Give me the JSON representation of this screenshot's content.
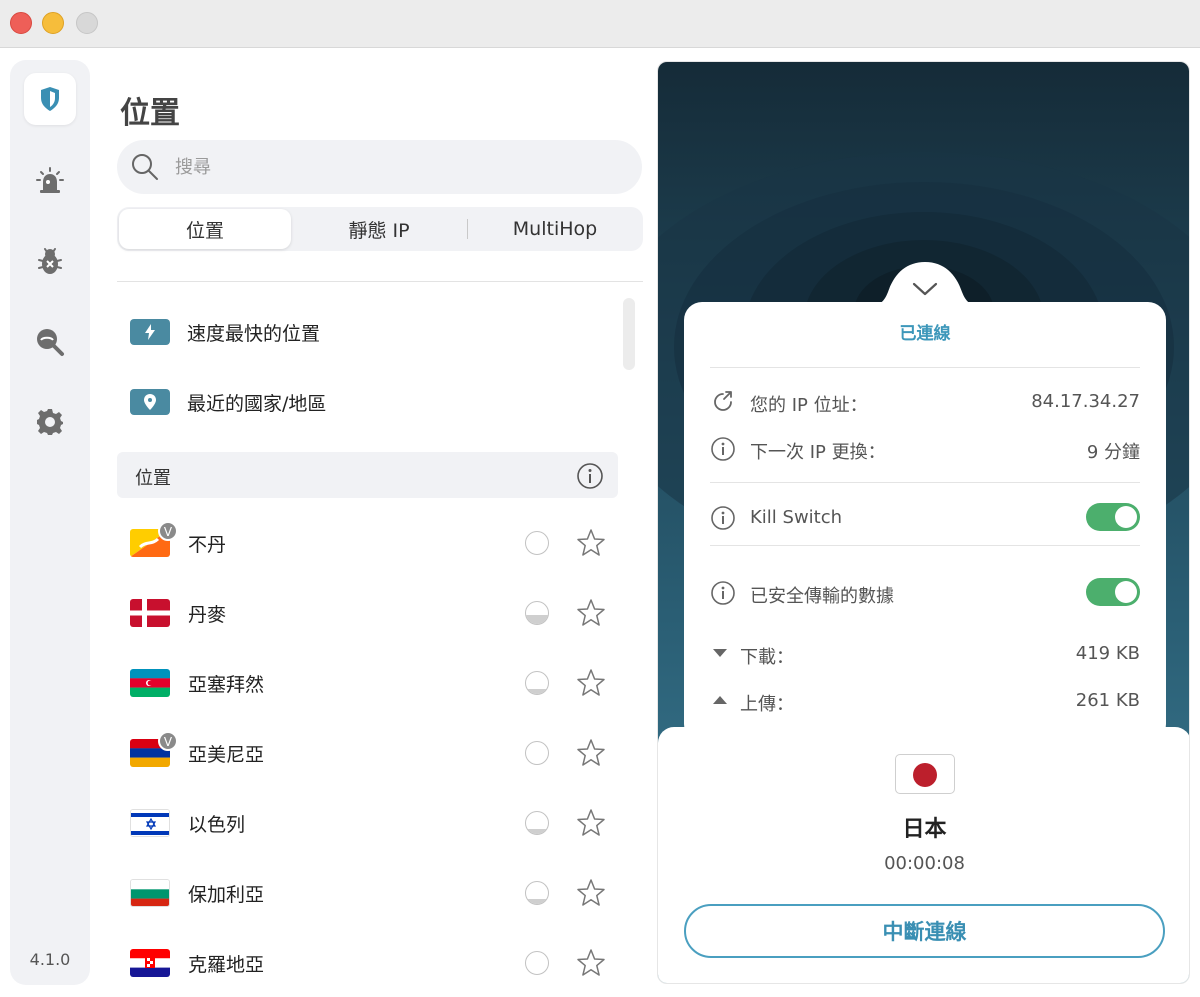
{
  "sidebar": {
    "items": [
      {
        "icon": "shield-icon",
        "active": true
      },
      {
        "icon": "alarm-icon"
      },
      {
        "icon": "bug-icon"
      },
      {
        "icon": "privacy-search-icon"
      },
      {
        "icon": "gear-icon"
      }
    ],
    "version": "4.1.0"
  },
  "main": {
    "title": "位置",
    "search": {
      "placeholder": "搜尋",
      "value": ""
    },
    "tabs": [
      {
        "label": "位置",
        "active": true
      },
      {
        "label": "靜態 IP"
      },
      {
        "label": "MultiHop"
      }
    ],
    "quick_items": [
      {
        "label": "速度最快的位置",
        "icon": "lightning-icon"
      },
      {
        "label": "最近的國家/地區",
        "icon": "location-pin-icon"
      }
    ],
    "section_header": "位置",
    "countries": [
      {
        "name": "不丹",
        "flag": "bhutan",
        "virtual": true,
        "v_label": "V",
        "load_pct": 0
      },
      {
        "name": "丹麥",
        "flag": "denmark",
        "virtual": false,
        "load_pct": 40
      },
      {
        "name": "亞塞拜然",
        "flag": "azerbaijan",
        "virtual": false,
        "load_pct": 25
      },
      {
        "name": "亞美尼亞",
        "flag": "armenia",
        "virtual": true,
        "v_label": "V",
        "load_pct": 0
      },
      {
        "name": "以色列",
        "flag": "israel",
        "virtual": false,
        "load_pct": 25
      },
      {
        "name": "保加利亞",
        "flag": "bulgaria",
        "virtual": false,
        "load_pct": 25
      },
      {
        "name": "克羅地亞",
        "flag": "croatia",
        "virtual": false,
        "load_pct": 0
      }
    ]
  },
  "status": {
    "connected_label": "已連線",
    "ip_label": "您的 IP 位址：",
    "ip_value": "84.17.34.27",
    "next_ip_label": "下一次 IP 更換：",
    "next_ip_value": "9 分鐘",
    "kill_switch_label": "Kill Switch",
    "kill_switch_on": true,
    "secure_data_label": "已安全傳輸的數據",
    "secure_data_on": true,
    "download_label": "下載：",
    "download_value": "419 KB",
    "upload_label": "上傳：",
    "upload_value": "261 KB"
  },
  "connection": {
    "country": "日本",
    "timer": "00:00:08",
    "disconnect_label": "中斷連線"
  },
  "colors": {
    "accent": "#3d97ba",
    "toggle_on": "#4caf6d",
    "badge": "#4a8aa1",
    "panel_bg_dark": "#152b38"
  }
}
